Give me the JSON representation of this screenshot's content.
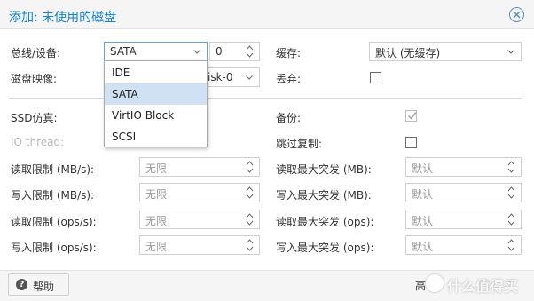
{
  "dialog": {
    "title": "添加: 未使用的磁盘"
  },
  "form": {
    "bus_label": "总线/设备:",
    "bus_value": "SATA",
    "device_value": "0",
    "cache_label": "缓存:",
    "cache_value": "默认 (无缓存)",
    "disk_image_label": "磁盘映像:",
    "disk_image_value": "isk-0",
    "discard_label": "丢弃:",
    "discard_checked": false,
    "ssd_label": "SSD仿真:",
    "backup_label": "备份:",
    "backup_checked": true,
    "iothread_label": "IO thread:",
    "skip_replication_label": "跳过复制:",
    "skip_replication_checked": false,
    "read_limit_mb_label": "读取限制 (MB/s):",
    "read_limit_mb_value": "无限",
    "read_burst_mb_label": "读取最大突发 (MB):",
    "read_burst_mb_value": "默认",
    "write_limit_mb_label": "写入限制 (MB/s):",
    "write_limit_mb_value": "无限",
    "write_burst_mb_label": "写入最大突发 (MB):",
    "write_burst_mb_value": "默认",
    "read_limit_ops_label": "读取限制 (ops/s):",
    "read_limit_ops_value": "无限",
    "read_burst_ops_label": "读取最大突发 (ops):",
    "read_burst_ops_value": "默认",
    "write_limit_ops_label": "写入限制 (ops/s):",
    "write_limit_ops_value": "无限",
    "write_burst_ops_label": "写入最大突发 (ops):",
    "write_burst_ops_value": "默认"
  },
  "bus_dropdown": {
    "options": [
      "IDE",
      "SATA",
      "VirtIO Block",
      "SCSI"
    ],
    "selected": "SATA"
  },
  "footer": {
    "help_label": "帮助",
    "advanced_label": "高",
    "watermark_text": "什么值得买"
  },
  "colors": {
    "accent": "#157fcc",
    "selected_row": "#cfe1f2",
    "focus_border": "#5fa2dd"
  }
}
